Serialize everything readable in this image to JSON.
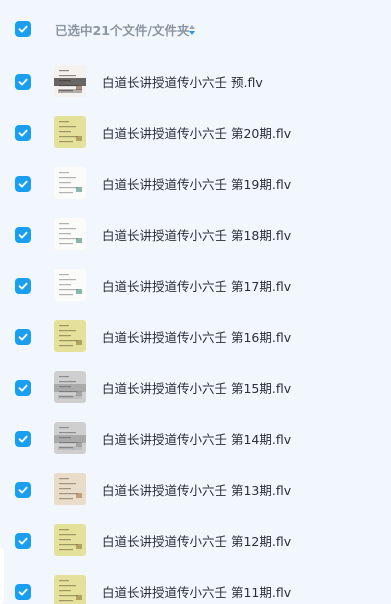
{
  "header": {
    "selection_text": "已选中21个文件/文件夹",
    "checkbox_checked": true,
    "sort_icon": "sort-updown-icon"
  },
  "colors": {
    "checkbox": "#1a9ff0",
    "background": "#f1f7fd",
    "header_text": "#8c96a3",
    "item_text": "#2a2f38"
  },
  "files": [
    {
      "name": "白道长讲授道传小六壬 预.flv",
      "checked": true,
      "thumb": "dark-slide"
    },
    {
      "name": "白道长讲授道传小六壬 第20期.flv",
      "checked": true,
      "thumb": "yellow-slide"
    },
    {
      "name": "白道长讲授道传小六壬 第19期.flv",
      "checked": true,
      "thumb": "white-slide"
    },
    {
      "name": "白道长讲授道传小六壬 第18期.flv",
      "checked": true,
      "thumb": "white-slide"
    },
    {
      "name": "白道长讲授道传小六壬 第17期.flv",
      "checked": true,
      "thumb": "white-slide"
    },
    {
      "name": "白道长讲授道传小六壬 第16期.flv",
      "checked": true,
      "thumb": "yellow-slide"
    },
    {
      "name": "白道长讲授道传小六壬 第15期.flv",
      "checked": true,
      "thumb": "gray-slide"
    },
    {
      "name": "白道长讲授道传小六壬 第14期.flv",
      "checked": true,
      "thumb": "gray-slide"
    },
    {
      "name": "白道长讲授道传小六壬 第13期.flv",
      "checked": true,
      "thumb": "beige-slide"
    },
    {
      "name": "白道长讲授道传小六壬 第12期.flv",
      "checked": true,
      "thumb": "yellow-slide"
    },
    {
      "name": "白道长讲授道传小六壬 第11期.flv",
      "checked": true,
      "thumb": "yellow-slide"
    }
  ]
}
